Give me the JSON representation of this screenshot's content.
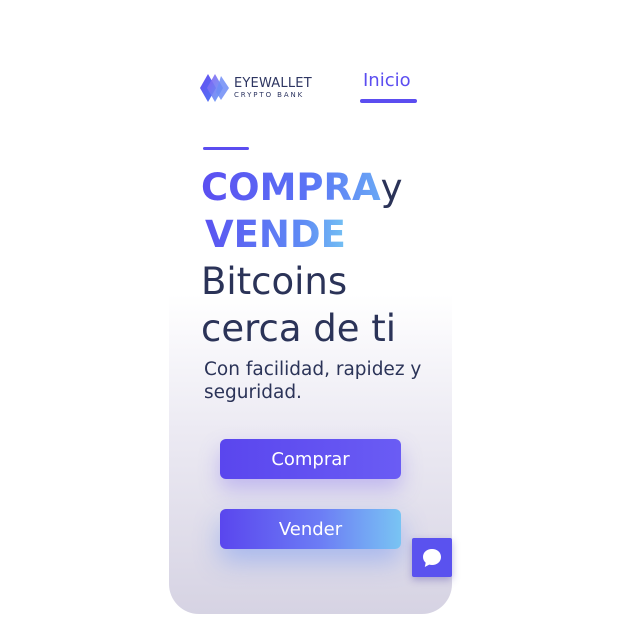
{
  "brand": {
    "name": "EYEWALLET",
    "tagline": "CRYPTO BANK",
    "logo_icon": "eyewallet-diamond-logo"
  },
  "nav": {
    "items": [
      {
        "label": "Inicio",
        "active": true
      }
    ]
  },
  "hero": {
    "word_compra": "COMPRA",
    "word_y": "y",
    "word_vende": "VENDE",
    "line_bitcoins": "Bitcoins",
    "line_cerca": "cerca de ti",
    "subtitle": "Con facilidad, rapidez y seguridad."
  },
  "actions": {
    "buy_label": "Comprar",
    "sell_label": "Vender"
  },
  "chat": {
    "icon": "chat-bubble-icon"
  },
  "colors": {
    "accent": "#5b4df0",
    "text_dark": "#2b3358",
    "gradient_end": "#79c4f3"
  }
}
